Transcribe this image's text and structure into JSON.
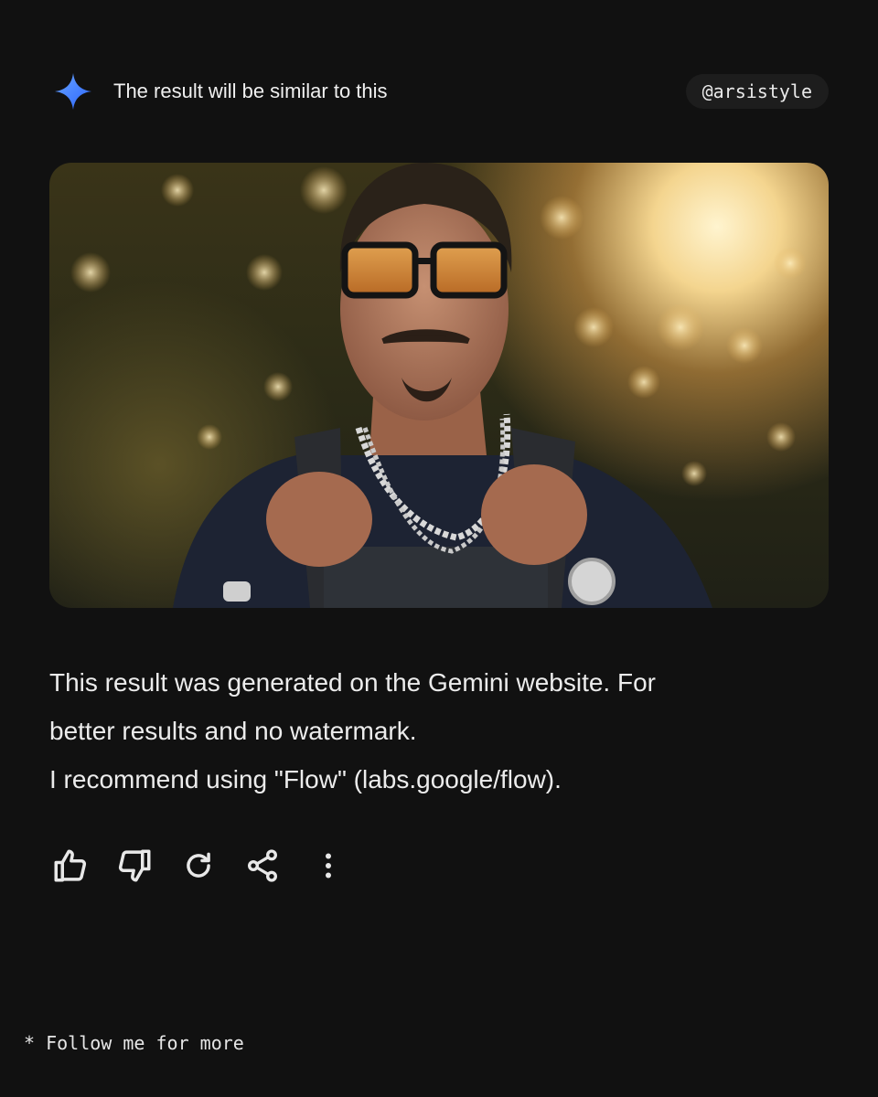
{
  "header": {
    "title": "The result will be similar to this",
    "handle": "@arsistyle",
    "icon": "gemini-sparkle-icon"
  },
  "image": {
    "description_icon": "generated-portrait-image"
  },
  "message": {
    "lines": [
      "This result was generated on the Gemini website. For",
      "better results and no watermark.",
      "I recommend using \"Flow\" (labs.google/flow)."
    ]
  },
  "actions": [
    {
      "icon": "thumbs-up-icon"
    },
    {
      "icon": "thumbs-down-icon"
    },
    {
      "icon": "regenerate-icon"
    },
    {
      "icon": "share-icon"
    },
    {
      "icon": "more-options-icon"
    }
  ],
  "footer": {
    "text": "* Follow me for more"
  },
  "colors": {
    "background": "#111111",
    "text": "#ececec",
    "pill": "#1d1d1d",
    "sparkle_start": "#4f8dff",
    "sparkle_end": "#2a63ff"
  }
}
